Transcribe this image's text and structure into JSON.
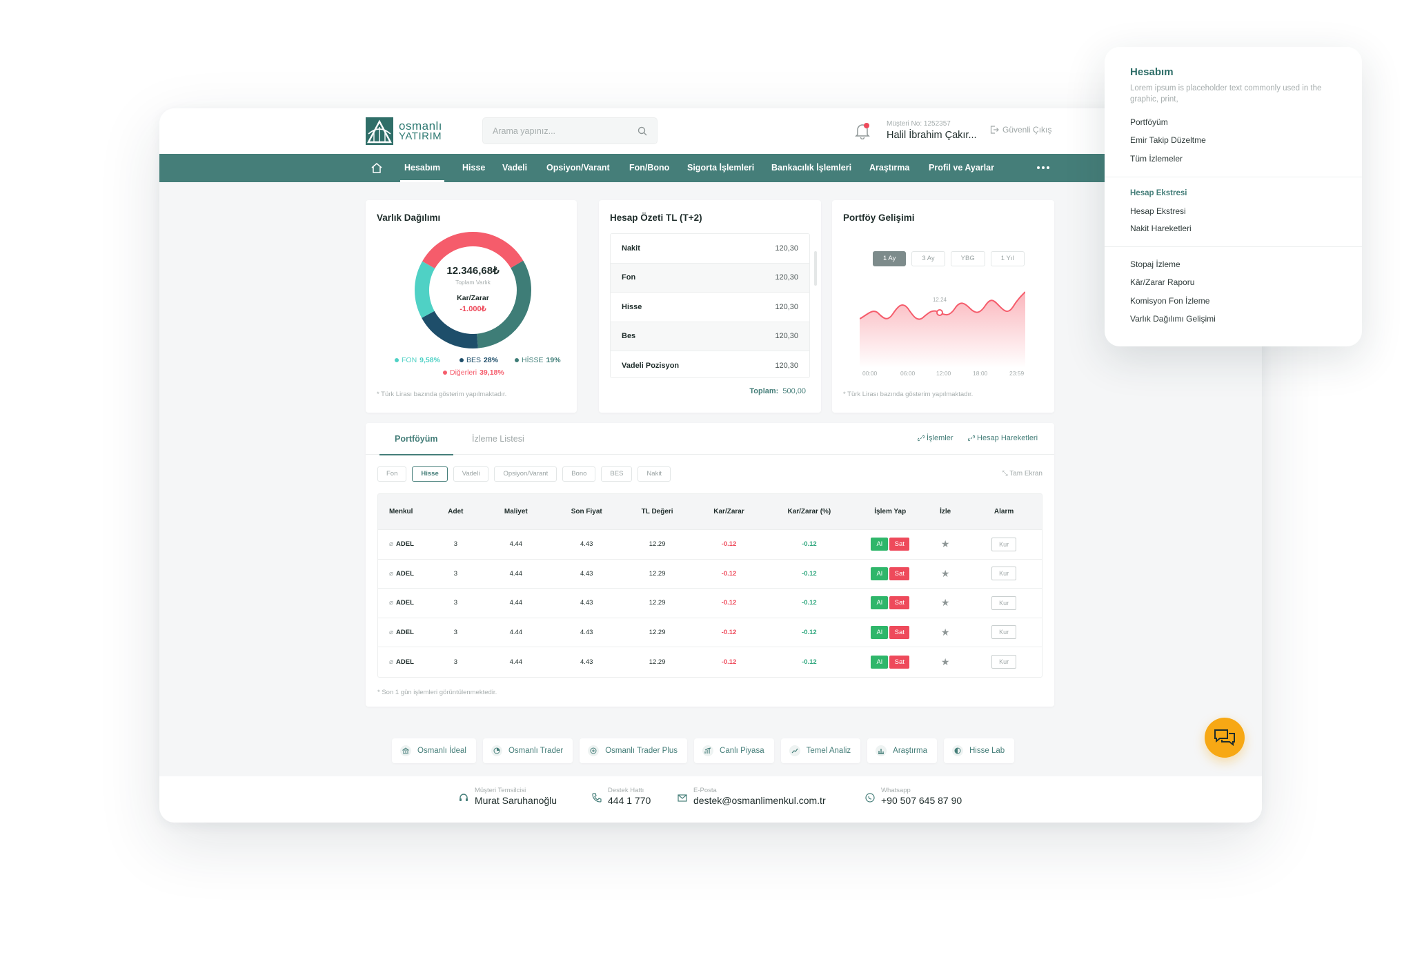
{
  "header": {
    "logo_line1": "osmanlı",
    "logo_line2": "YATIRIM",
    "search_placeholder": "Arama yapınız...",
    "customer_no": "Müşteri No: 1252357",
    "customer_name": "Halil İbrahim Çakır...",
    "logout": "Güvenli Çıkış"
  },
  "nav": {
    "items": [
      "Hesabım",
      "Hisse",
      "Vadeli",
      "Opsiyon/Varant",
      "Fon/Bono",
      "Sigorta İşlemleri",
      "Bankacılık İşlemleri",
      "Araştırma",
      "Profil ve Ayarlar"
    ],
    "active": "Hesabım"
  },
  "asset_card": {
    "title": "Varlık Dağılımı",
    "total": "12.346,68₺",
    "total_label": "Toplam Varlık",
    "pl_label": "Kar/Zarar",
    "pl_value": "-1.000₺",
    "legend": [
      {
        "name": "FON",
        "pct": "9,58%",
        "color": "#4fd1c5"
      },
      {
        "name": "BES",
        "pct": "28%",
        "color": "#1e4e6a"
      },
      {
        "name": "HİSSE",
        "pct": "19%",
        "color": "#3e7d77"
      },
      {
        "name": "Diğerleri",
        "pct": "39,18%",
        "color": "#f55c6b"
      }
    ],
    "footnote": "* Türk Lirası bazında gösterim yapılmaktadır."
  },
  "summary_card": {
    "title": "Hesap Özeti TL (T+2)",
    "rows": [
      {
        "label": "Nakit",
        "value": "120,30"
      },
      {
        "label": "Fon",
        "value": "120,30"
      },
      {
        "label": "Hisse",
        "value": "120,30"
      },
      {
        "label": "Bes",
        "value": "120,30"
      },
      {
        "label": "Vadeli Pozisyon",
        "value": "120,30"
      }
    ],
    "total_label": "Toplam:",
    "total_value": "500,00"
  },
  "growth_card": {
    "title": "Portföy Gelişimi",
    "periods": [
      "1 Ay",
      "3 Ay",
      "YBG",
      "1 Yıl"
    ],
    "active_period": "1 Ay",
    "marker_label": "12.24",
    "x_labels": [
      "00:00",
      "06:00",
      "12:00",
      "18:00",
      "23:59"
    ],
    "footnote": "* Türk Lirası bazında gösterim yapılmaktadır."
  },
  "portfolio": {
    "tabs": [
      "Portföyüm",
      "İzleme Listesi"
    ],
    "active_tab": "Portföyüm",
    "links": [
      "İşlemler",
      "Hesap Hareketleri"
    ],
    "filters": [
      "Fon",
      "Hisse",
      "Vadeli",
      "Opsiyon/Varant",
      "Bono",
      "BES",
      "Nakit"
    ],
    "active_filter": "Hisse",
    "fullscreen": "Tam Ekran",
    "columns": [
      "Menkul",
      "Adet",
      "Maliyet",
      "Son Fiyat",
      "TL Değeri",
      "Kar/Zarar",
      "Kar/Zarar (%)",
      "İşlem Yap",
      "İzle",
      "Alarm"
    ],
    "rows": [
      {
        "menkul": "ADEL",
        "adet": "3",
        "maliyet": "4.44",
        "son": "4.43",
        "tl": "12.29",
        "kz": "-0.12",
        "kzp": "-0.12"
      },
      {
        "menkul": "ADEL",
        "adet": "3",
        "maliyet": "4.44",
        "son": "4.43",
        "tl": "12.29",
        "kz": "-0.12",
        "kzp": "-0.12"
      },
      {
        "menkul": "ADEL",
        "adet": "3",
        "maliyet": "4.44",
        "son": "4.43",
        "tl": "12.29",
        "kz": "-0.12",
        "kzp": "-0.12"
      },
      {
        "menkul": "ADEL",
        "adet": "3",
        "maliyet": "4.44",
        "son": "4.43",
        "tl": "12.29",
        "kz": "-0.12",
        "kzp": "-0.12"
      },
      {
        "menkul": "ADEL",
        "adet": "3",
        "maliyet": "4.44",
        "son": "4.43",
        "tl": "12.29",
        "kz": "-0.12",
        "kzp": "-0.12"
      }
    ],
    "buy_label": "Al",
    "sell_label": "Sat",
    "alarm_label": "Kur",
    "footnote": "* Son 1 gün işlemleri görüntülenmektedir."
  },
  "quick_links": [
    "Osmanlı İdeal",
    "Osmanlı Trader",
    "Osmanlı Trader Plus",
    "Canlı Piyasa",
    "Temel Analiz",
    "Araştırma",
    "Hisse Lab"
  ],
  "footer": {
    "rep_label": "Müşteri Temsilcisi",
    "rep_value": "Murat Saruhanoğlu",
    "hotline_label": "Destek Hattı",
    "hotline_value": "444 1 770",
    "email_label": "E-Posta",
    "email_value": "destek@osmanlimenkul.com.tr",
    "whatsapp_label": "Whatsapp",
    "whatsapp_value": "+90 507 645 87 90"
  },
  "menu": {
    "title": "Hesabım",
    "desc": "Lorem ipsum is placeholder text commonly used in the graphic, print,",
    "group1": [
      "Portföyüm",
      "Emir Takip Düzeltme",
      "Tüm İzlemeler"
    ],
    "group2_head": "Hesap Ekstresi",
    "group2": [
      "Hesap Ekstresi",
      "Nakit Hareketleri"
    ],
    "group3": [
      "Stopaj İzleme",
      "Kâr/Zarar Raporu",
      "Komisyon Fon İzleme",
      "Varlık Dağılımı Gelişimi"
    ]
  },
  "colors": {
    "brand": "#457e79",
    "negative": "#ee4a5b",
    "positive": "#2fa77e",
    "chat": "#f7a814"
  }
}
